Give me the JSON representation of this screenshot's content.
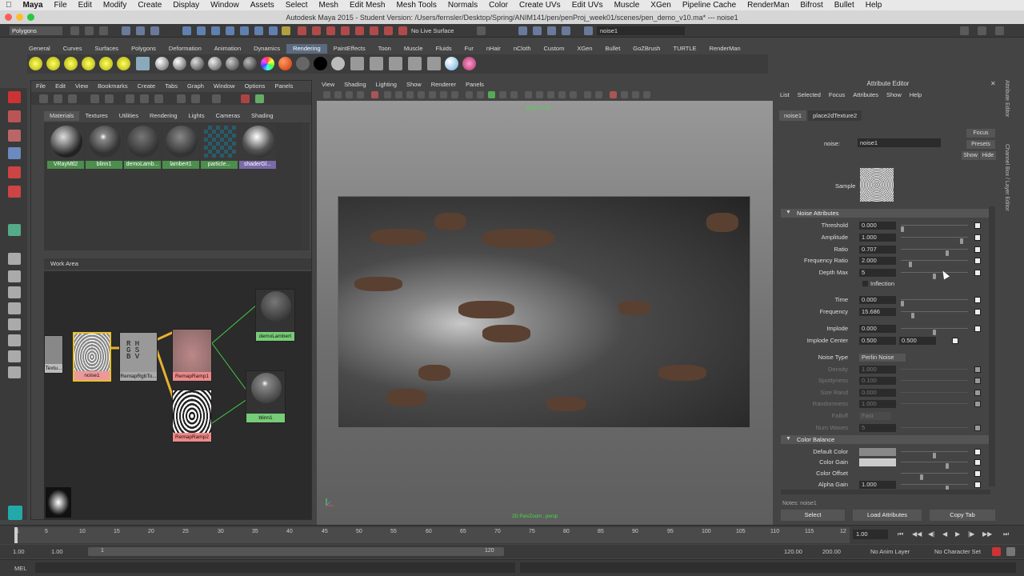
{
  "mac_menu": [
    "Maya",
    "File",
    "Edit",
    "Modify",
    "Create",
    "Display",
    "Window",
    "Assets",
    "Select",
    "Mesh",
    "Edit Mesh",
    "Mesh Tools",
    "Normals",
    "Color",
    "Create UVs",
    "Edit UVs",
    "Muscle",
    "XGen",
    "Pipeline Cache",
    "RenderMan",
    "Bifrost",
    "Bullet",
    "Help"
  ],
  "window_title": "Autodesk Maya 2015 - Student Version: /Users/fernsler/Desktop/Spring/ANIM141/pen/penProj_week01/scenes/pen_demo_v10.ma*  ---  noise1",
  "statusline": {
    "mode": "Polygons",
    "live_surface": "No Live Surface",
    "object_field": "noise1"
  },
  "shelf_tabs": [
    "General",
    "Curves",
    "Surfaces",
    "Polygons",
    "Deformation",
    "Animation",
    "Dynamics",
    "Rendering",
    "PaintEffects",
    "Toon",
    "Muscle",
    "Fluids",
    "Fur",
    "nHair",
    "nCloth",
    "Custom",
    "XGen",
    "Bullet",
    "GoZBrush",
    "TURTLE",
    "RenderMan"
  ],
  "shelf_active": "Rendering",
  "hypershade": {
    "menu": [
      "File",
      "Edit",
      "View",
      "Bookmarks",
      "Create",
      "Tabs",
      "Graph",
      "Window",
      "Options",
      "Panels"
    ],
    "tabs": [
      "Materials",
      "Textures",
      "Utilities",
      "Rendering",
      "Lights",
      "Cameras",
      "Shading"
    ],
    "swatches": [
      "VRayMtl2",
      "blinn1",
      "demoLamb...",
      "lambert1",
      "particle...",
      "shaderGl..."
    ],
    "work_area_label": "Work Area",
    "nodes": {
      "texture_stub": "Textu...",
      "noise": "noise1",
      "remap_rgb": "RemapRgbTo...",
      "ramp1": "RemapRamp1",
      "ramp2": "RemapRamp2",
      "demo_lambert": "demoLambert",
      "blinn": "blinn1"
    }
  },
  "viewport": {
    "menu": [
      "View",
      "Shading",
      "Lighting",
      "Show",
      "Renderer",
      "Panels"
    ],
    "resolution": "1280 x 720",
    "footer": "2D Pan/Zoom : persp"
  },
  "attribute_editor": {
    "title": "Attribute Editor",
    "menu": [
      "List",
      "Selected",
      "Focus",
      "Attributes",
      "Show",
      "Help"
    ],
    "tabs": [
      "noise1",
      "place2dTexture2"
    ],
    "name_label": "noise:",
    "name_value": "noise1",
    "focus": "Focus",
    "presets": "Presets",
    "show": "Show",
    "hide": "Hide",
    "sample_label": "Sample",
    "noise_section": "Noise Attributes",
    "inflection": "Inflection",
    "attrs": [
      {
        "label": "Threshold",
        "value": "0.000",
        "level": 0.0
      },
      {
        "label": "Amplitude",
        "value": "1.000",
        "level": 0.92
      },
      {
        "label": "Ratio",
        "value": "0.707",
        "level": 0.7
      },
      {
        "label": "Frequency Ratio",
        "value": "2.000",
        "level": 0.12
      },
      {
        "label": "Depth Max",
        "value": "5",
        "level": 0.5
      },
      {
        "label": "Time",
        "value": "0.000",
        "level": 0.0
      },
      {
        "label": "Frequency",
        "value": "15.686",
        "level": 0.16
      },
      {
        "label": "Implode",
        "value": "0.000",
        "level": 0.5
      }
    ],
    "implode_center_label": "Implode Center",
    "implode_center": [
      "0.500",
      "0.500"
    ],
    "noise_type_label": "Noise Type",
    "noise_type": "Perlin Noise",
    "dim_attrs": [
      {
        "label": "Density",
        "value": "1.000"
      },
      {
        "label": "Spottyness",
        "value": "0.100"
      },
      {
        "label": "Size Rand",
        "value": "0.000"
      },
      {
        "label": "Randomness",
        "value": "1.000"
      }
    ],
    "falloff_label": "Falloff",
    "falloff_value": "Fast",
    "num_waves_label": "Num Waves",
    "num_waves_value": "5",
    "color_section": "Color Balance",
    "color_attrs": [
      "Default Color",
      "Color Gain",
      "Color Offset"
    ],
    "alpha_gain_label": "Alpha Gain",
    "alpha_gain_value": "1.000",
    "notes": "Notes:  noise1",
    "buttons": [
      "Select",
      "Load Attributes",
      "Copy Tab"
    ]
  },
  "side_tabs": [
    "Attribute Editor",
    "Channel Box / Layer Editor"
  ],
  "timeline": {
    "ticks": [
      "1",
      "5",
      "10",
      "15",
      "20",
      "25",
      "30",
      "35",
      "40",
      "45",
      "50",
      "55",
      "60",
      "65",
      "70",
      "75",
      "80",
      "85",
      "90",
      "95",
      "100",
      "105",
      "110",
      "115",
      "12"
    ],
    "current": "1.00"
  },
  "range": {
    "start": "1.00",
    "start2": "1.00",
    "slider_start": "1",
    "slider_end": "120",
    "end": "120.00",
    "end2": "200.00",
    "anim_layer": "No Anim Layer",
    "char_set": "No Character Set"
  },
  "mel_label": "MEL"
}
